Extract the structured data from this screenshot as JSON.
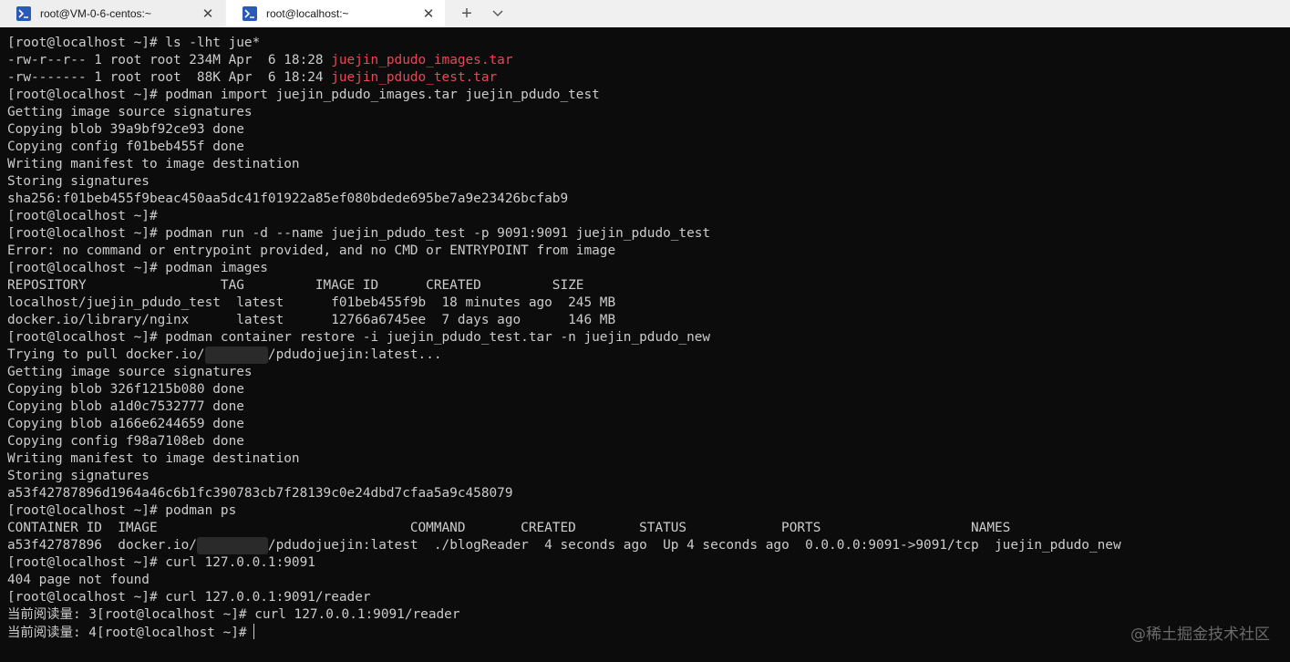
{
  "tabs": [
    {
      "title": "root@VM-0-6-centos:~",
      "close": "✕"
    },
    {
      "title": "root@localhost:~",
      "close": "✕"
    }
  ],
  "new_tab": "+",
  "lines": [
    {
      "segments": [
        {
          "text": "[root@localhost ~]# ls -lht jue*"
        }
      ]
    },
    {
      "segments": [
        {
          "text": "-rw-r--r-- 1 root root 234M Apr  6 18:28 "
        },
        {
          "text": "juejin_pdudo_images.tar",
          "cls": "red"
        }
      ]
    },
    {
      "segments": [
        {
          "text": "-rw------- 1 root root  88K Apr  6 18:24 "
        },
        {
          "text": "juejin_pdudo_test.tar",
          "cls": "red"
        }
      ]
    },
    {
      "segments": [
        {
          "text": "[root@localhost ~]# podman import juejin_pdudo_images.tar juejin_pdudo_test"
        }
      ]
    },
    {
      "segments": [
        {
          "text": "Getting image source signatures"
        }
      ]
    },
    {
      "segments": [
        {
          "text": "Copying blob 39a9bf92ce93 done"
        }
      ]
    },
    {
      "segments": [
        {
          "text": "Copying config f01beb455f done"
        }
      ]
    },
    {
      "segments": [
        {
          "text": "Writing manifest to image destination"
        }
      ]
    },
    {
      "segments": [
        {
          "text": "Storing signatures"
        }
      ]
    },
    {
      "segments": [
        {
          "text": "sha256:f01beb455f9beac450aa5dc41f01922a85ef080bdede695be7a9e23426bcfab9"
        }
      ]
    },
    {
      "segments": [
        {
          "text": "[root@localhost ~]#"
        }
      ]
    },
    {
      "segments": [
        {
          "text": "[root@localhost ~]# podman run -d --name juejin_pdudo_test -p 9091:9091 juejin_pdudo_test"
        }
      ]
    },
    {
      "segments": [
        {
          "text": "Error: no command or entrypoint provided, and no CMD or ENTRYPOINT from image"
        }
      ]
    },
    {
      "segments": [
        {
          "text": "[root@localhost ~]# podman images"
        }
      ]
    },
    {
      "segments": [
        {
          "text": "REPOSITORY                 TAG         IMAGE ID      CREATED         SIZE"
        }
      ]
    },
    {
      "segments": [
        {
          "text": "localhost/juejin_pdudo_test  latest      f01beb455f9b  18 minutes ago  245 MB"
        }
      ]
    },
    {
      "segments": [
        {
          "text": "docker.io/library/nginx      latest      12766a6745ee  7 days ago      146 MB"
        }
      ]
    },
    {
      "segments": [
        {
          "text": "[root@localhost ~]# podman container restore -i juejin_pdudo_test.tar -n juejin_pdudo_new"
        }
      ]
    },
    {
      "segments": [
        {
          "text": "Trying to pull docker.io/"
        },
        {
          "text": "xxxxxxxx",
          "cls": "redact"
        },
        {
          "text": "/pdudojuejin:latest..."
        }
      ]
    },
    {
      "segments": [
        {
          "text": "Getting image source signatures"
        }
      ]
    },
    {
      "segments": [
        {
          "text": "Copying blob 326f1215b080 done"
        }
      ]
    },
    {
      "segments": [
        {
          "text": "Copying blob a1d0c7532777 done"
        }
      ]
    },
    {
      "segments": [
        {
          "text": "Copying blob a166e6244659 done"
        }
      ]
    },
    {
      "segments": [
        {
          "text": "Copying config f98a7108eb done"
        }
      ]
    },
    {
      "segments": [
        {
          "text": "Writing manifest to image destination"
        }
      ]
    },
    {
      "segments": [
        {
          "text": "Storing signatures"
        }
      ]
    },
    {
      "segments": [
        {
          "text": "a53f42787896d1964a46c6b1fc390783cb7f28139c0e24dbd7cfaa5a9c458079"
        }
      ]
    },
    {
      "segments": [
        {
          "text": "[root@localhost ~]# podman ps"
        }
      ]
    },
    {
      "segments": [
        {
          "text": "CONTAINER ID  IMAGE                                COMMAND       CREATED        STATUS            PORTS                   NAMES"
        }
      ]
    },
    {
      "segments": [
        {
          "text": "a53f42787896  docker.io/"
        },
        {
          "text": "xxxxxxxxx",
          "cls": "redact"
        },
        {
          "text": "/pdudojuejin:latest  ./blogReader  4 seconds ago  Up 4 seconds ago  0.0.0.0:9091->9091/tcp  juejin_pdudo_new"
        }
      ]
    },
    {
      "segments": [
        {
          "text": "[root@localhost ~]# curl 127.0.0.1:9091"
        }
      ]
    },
    {
      "segments": [
        {
          "text": "404 page not found"
        }
      ]
    },
    {
      "segments": [
        {
          "text": "[root@localhost ~]# curl 127.0.0.1:9091/reader"
        }
      ]
    },
    {
      "segments": [
        {
          "text": "当前阅读量: 3[root@localhost ~]# curl 127.0.0.1:9091/reader"
        }
      ]
    },
    {
      "segments": [
        {
          "text": "当前阅读量: 4[root@localhost ~]#"
        }
      ],
      "cursor": true
    }
  ],
  "watermark": "@稀土掘金技术社区",
  "colors": {
    "background": "#0c0c0c",
    "foreground": "#cccccc",
    "archive": "#e74856"
  }
}
